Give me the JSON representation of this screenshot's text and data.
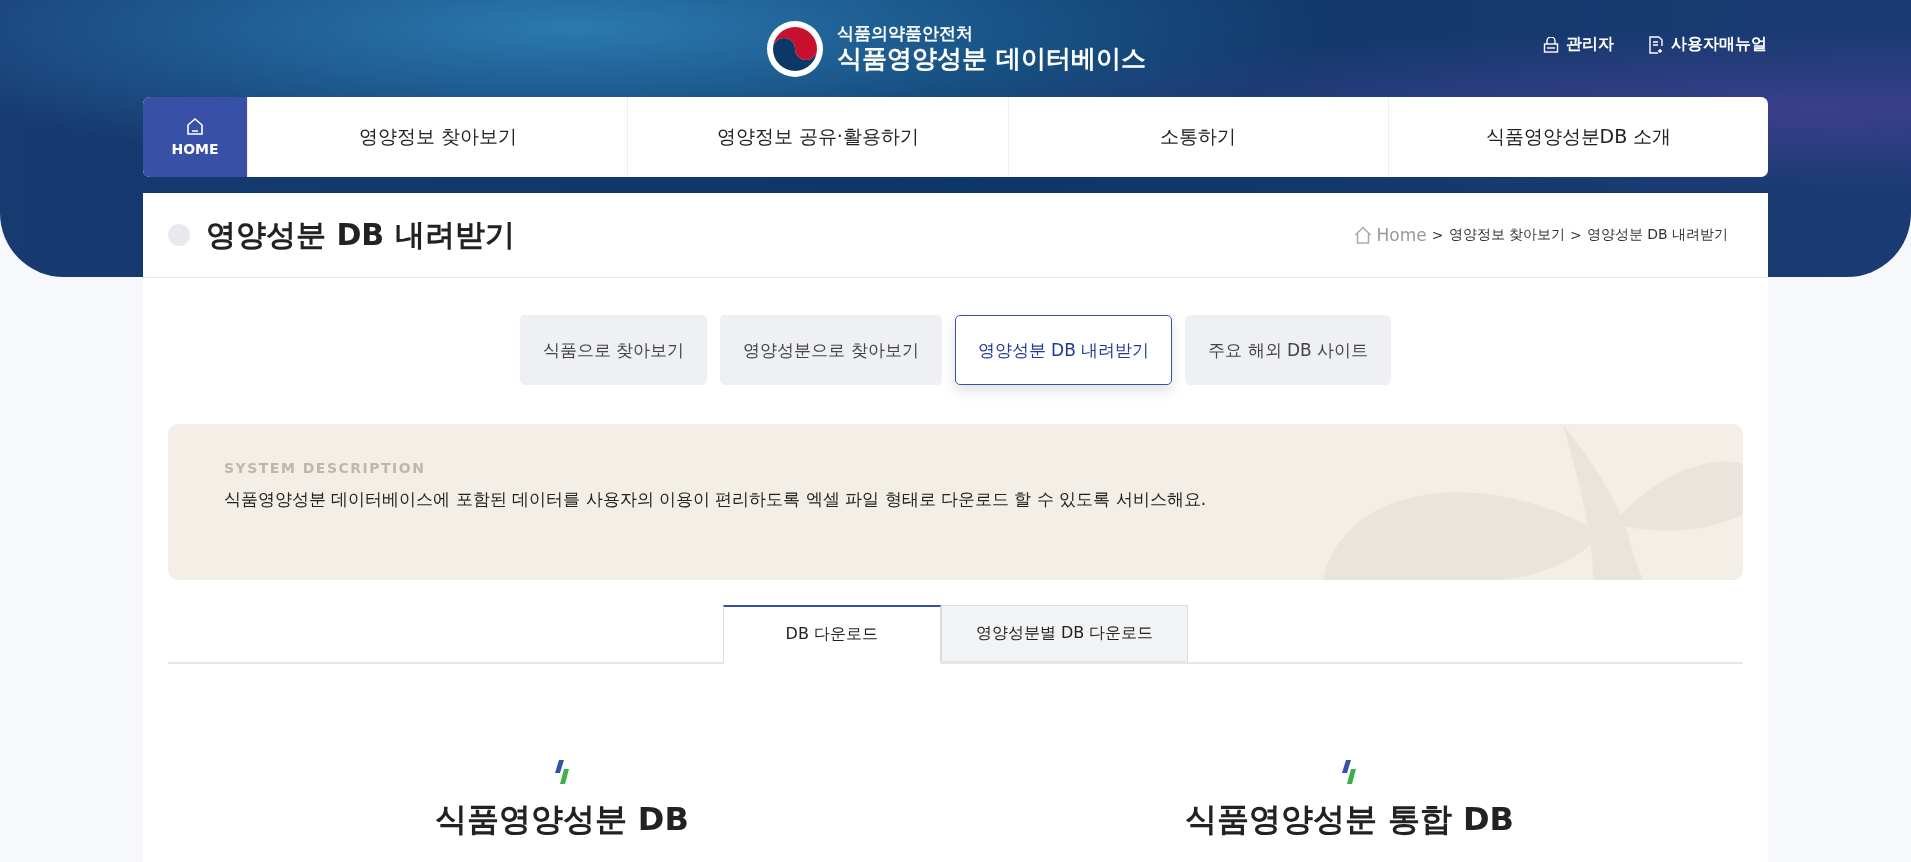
{
  "header": {
    "agency": "식품의약품안전처",
    "site_title": "식품영양성분 데이터베이스",
    "utility_links": [
      {
        "kind": "admin",
        "label": "관리자"
      },
      {
        "kind": "manual",
        "label": "사용자매뉴얼"
      }
    ]
  },
  "main_nav": {
    "home": {
      "label": "HOME",
      "selected": true
    },
    "items": [
      {
        "label": "영양정보 찾아보기"
      },
      {
        "label": "영양정보 공유·활용하기"
      },
      {
        "label": "소통하기"
      },
      {
        "label": "식품영양성분DB 소개"
      }
    ]
  },
  "page_title": "영양성분 DB 내려받기",
  "breadcrumb": [
    {
      "label": "Home"
    },
    {
      "separator": ">",
      "label": "영양정보 찾아보기"
    },
    {
      "separator": ">",
      "label": "영양성분 DB 내려받기"
    }
  ],
  "sub_tabs": [
    {
      "label": "식품으로 찾아보기",
      "selected": false
    },
    {
      "label": "영양성분으로 찾아보기",
      "selected": false
    },
    {
      "label": "영양성분 DB 내려받기",
      "selected": true
    },
    {
      "label": "주요 해외 DB 사이트",
      "selected": false
    }
  ],
  "description": {
    "eyebrow": "SYSTEM DESCRIPTION",
    "text": "식품영양성분 데이터베이스에 포함된 데이터를 사용자의 이용이 편리하도록 엑셀 파일 형태로 다운로드 할 수 있도록 서비스해요."
  },
  "download_tabs": [
    {
      "label": "DB 다운로드",
      "selected": true
    },
    {
      "label": "영양성분별 DB 다운로드",
      "selected": false
    }
  ],
  "sections": [
    {
      "title": "식품영양성분 DB"
    },
    {
      "title": "식품영양성분 통합 DB"
    }
  ]
}
